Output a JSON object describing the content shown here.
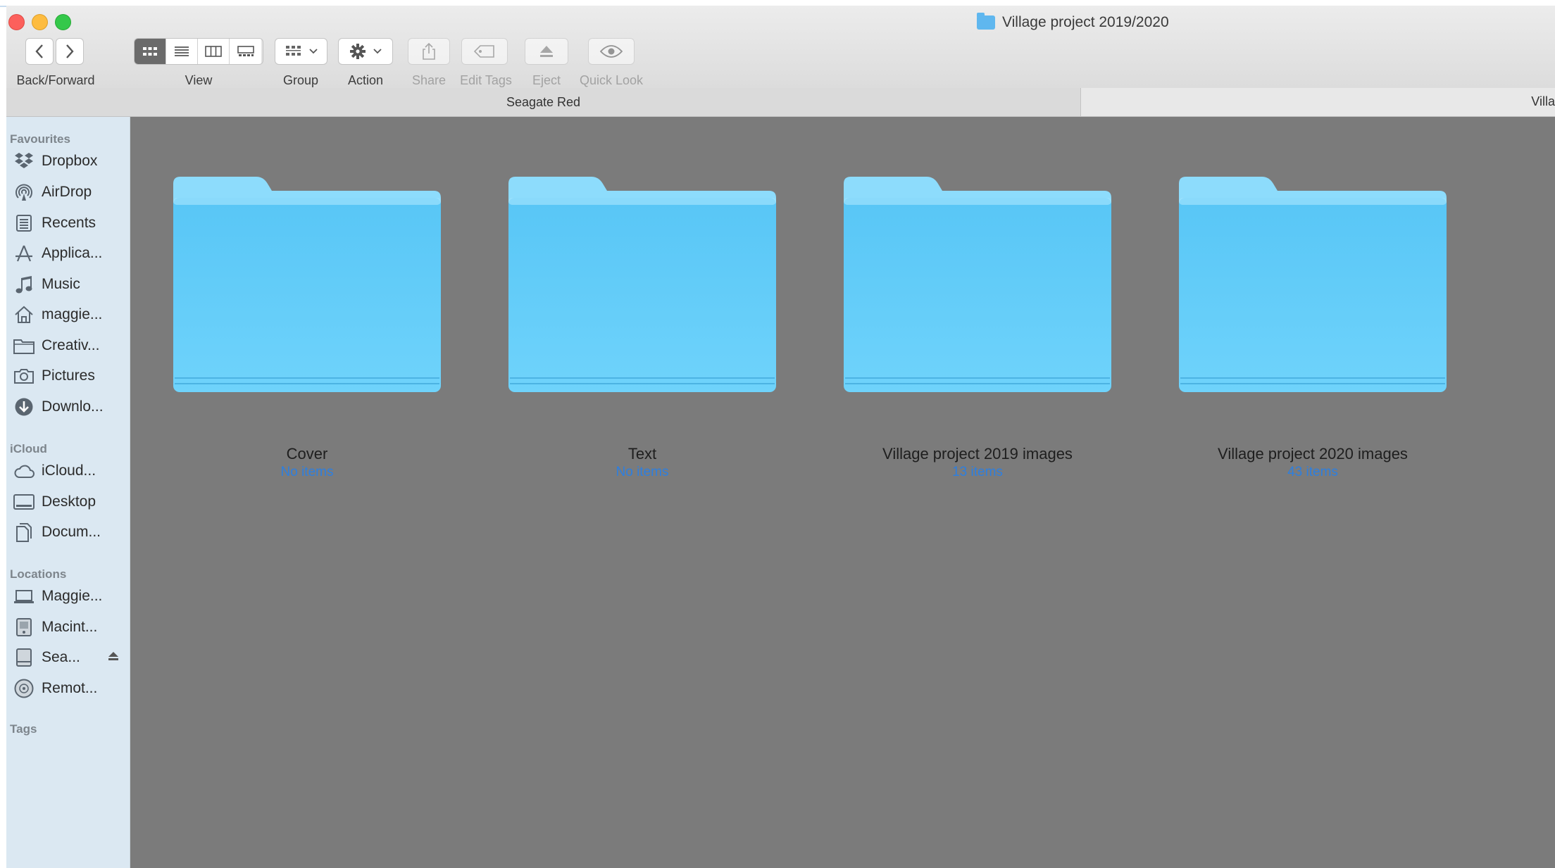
{
  "window": {
    "title": "Village project 2019/2020"
  },
  "toolbar": {
    "back_forward_label": "Back/Forward",
    "view_label": "View",
    "group_label": "Group",
    "action_label": "Action",
    "share_label": "Share",
    "edit_tags_label": "Edit Tags",
    "eject_label": "Eject",
    "quick_look_label": "Quick Look",
    "active_view": "icon"
  },
  "pathbar": {
    "segments": [
      "Seagate Red",
      "Villa"
    ]
  },
  "sidebar": {
    "favourites_heading": "Favourites",
    "favourites": [
      {
        "label": "Dropbox",
        "icon": "dropbox-icon"
      },
      {
        "label": "AirDrop",
        "icon": "airdrop-icon"
      },
      {
        "label": "Recents",
        "icon": "recents-icon"
      },
      {
        "label": "Applica...",
        "icon": "applications-icon"
      },
      {
        "label": "Music",
        "icon": "music-icon"
      },
      {
        "label": "maggie...",
        "icon": "home-icon"
      },
      {
        "label": "Creativ...",
        "icon": "folder-icon"
      },
      {
        "label": "Pictures",
        "icon": "camera-icon"
      },
      {
        "label": "Downlo...",
        "icon": "download-icon"
      }
    ],
    "icloud_heading": "iCloud",
    "icloud": [
      {
        "label": "iCloud...",
        "icon": "cloud-icon"
      },
      {
        "label": "Desktop",
        "icon": "desktop-icon"
      },
      {
        "label": "Docum...",
        "icon": "document-icon"
      }
    ],
    "locations_heading": "Locations",
    "locations": [
      {
        "label": "Maggie...",
        "icon": "laptop-icon"
      },
      {
        "label": "Macint...",
        "icon": "hard-drive-icon"
      },
      {
        "label": "Sea...",
        "icon": "external-drive-icon"
      },
      {
        "label": "Remot...",
        "icon": "disc-icon"
      }
    ],
    "tags_heading": "Tags"
  },
  "content": {
    "folders": [
      {
        "name": "Cover",
        "count": "No items"
      },
      {
        "name": "Text",
        "count": "No items"
      },
      {
        "name": "Village project 2019 images",
        "count": "13 items"
      },
      {
        "name": "Village project 2020 images",
        "count": "43 items"
      }
    ]
  },
  "colors": {
    "folder_blue": "#5ec8f7",
    "item_count_blue": "#2d7fe0",
    "content_bg": "#7b7b7b",
    "sidebar_bg": "#dbe8f2"
  }
}
